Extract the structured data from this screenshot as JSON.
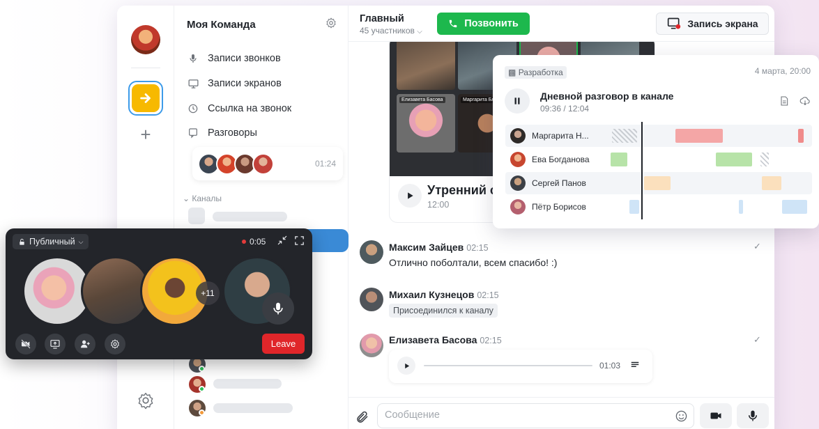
{
  "sidebar": {
    "team_name": "Моя Команда",
    "items": [
      {
        "label": "Записи звонков",
        "icon": "mic-icon"
      },
      {
        "label": "Записи экранов",
        "icon": "screen-icon"
      },
      {
        "label": "Ссылка на звонок",
        "icon": "clock-icon"
      },
      {
        "label": "Разговоры",
        "icon": "chat-icon"
      }
    ],
    "conversation_time": "01:24",
    "channels_label": "Каналы"
  },
  "header": {
    "channel_title": "Главный",
    "participants": "45 участников",
    "call_label": "Позвонить",
    "screen_record_label": "Запись экрана"
  },
  "media": {
    "title": "Утренний с",
    "time": "12:00",
    "tile_labels": [
      "Елизавета Басова",
      "Маргарита Блок"
    ]
  },
  "messages": [
    {
      "name": "Максим Зайцев",
      "time": "02:15",
      "text": "Отлично поболтали, всем спасибо! :)",
      "read": "✓"
    },
    {
      "name": "Михаил Кузнецов",
      "time": "02:15",
      "system": "Присоединился к каналу"
    },
    {
      "name": "Елизавета Басова",
      "time": "02:15",
      "audio_duration": "01:03",
      "read": "✓"
    }
  ],
  "composer": {
    "placeholder": "Сообщение"
  },
  "popup": {
    "tag": "Разработка",
    "date": "4 марта, 20:00",
    "title": "Дневной разговор в канале",
    "progress": "09:36 / 12:04",
    "participants": [
      {
        "name": "Маргарита Н...",
        "color": "#f4a6a6"
      },
      {
        "name": "Ева Богданова",
        "color": "#b7e3a8"
      },
      {
        "name": "Сергей Панов",
        "color": "#fbe0bd"
      },
      {
        "name": "Пётр Борисов",
        "color": "#cfe4f7"
      }
    ]
  },
  "call_widget": {
    "visibility": "Публичный",
    "duration": "0:05",
    "extra_count": "+11",
    "leave_label": "Leave"
  },
  "colors": {
    "accent_green": "#1db84d",
    "leave_red": "#e0262a",
    "team_yellow": "#f7b900",
    "selection_blue": "#3a8ad6"
  }
}
